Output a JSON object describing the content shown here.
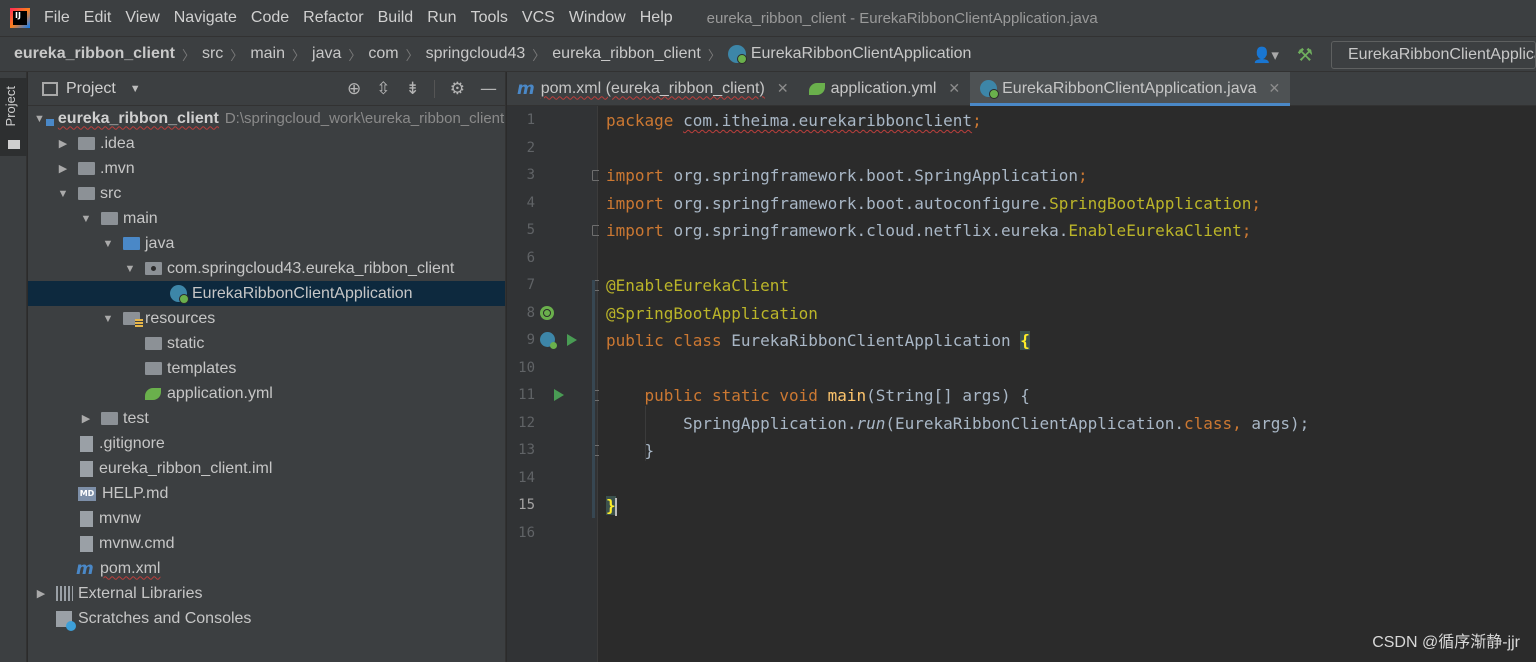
{
  "menubar": {
    "logo_text": "IJ",
    "items": [
      "File",
      "Edit",
      "View",
      "Navigate",
      "Code",
      "Refactor",
      "Build",
      "Run",
      "Tools",
      "VCS",
      "Window",
      "Help"
    ],
    "window_title": "eureka_ribbon_client - EurekaRibbonClientApplication.java"
  },
  "breadcrumb": [
    "eureka_ribbon_client",
    "src",
    "main",
    "java",
    "com",
    "springcloud43",
    "eureka_ribbon_client",
    "EurekaRibbonClientApplication"
  ],
  "toolbar": {
    "run_config": "EurekaRibbonClientApplication",
    "user_icon": "user-icon",
    "build_icon": "hammer-icon"
  },
  "left_strip": {
    "project_label": "Project"
  },
  "project_panel": {
    "title": "Project",
    "tree": [
      {
        "name": "eureka_ribbon_client",
        "path": "D:\\springcloud_work\\eureka_ribbon_client",
        "icon": "project-folder",
        "expanded": true
      },
      {
        "name": ".idea",
        "icon": "folder",
        "expanded": false
      },
      {
        "name": ".mvn",
        "icon": "folder",
        "expanded": false
      },
      {
        "name": "src",
        "icon": "folder",
        "expanded": true
      },
      {
        "name": "main",
        "icon": "folder",
        "expanded": true
      },
      {
        "name": "java",
        "icon": "source-folder",
        "expanded": true
      },
      {
        "name": "com.springcloud43.eureka_ribbon_client",
        "icon": "package",
        "expanded": true
      },
      {
        "name": "EurekaRibbonClientApplication",
        "icon": "spring-class",
        "selected": true
      },
      {
        "name": "resources",
        "icon": "resources-folder",
        "expanded": true
      },
      {
        "name": "static",
        "icon": "folder"
      },
      {
        "name": "templates",
        "icon": "folder"
      },
      {
        "name": "application.yml",
        "icon": "spring-yml"
      },
      {
        "name": "test",
        "icon": "folder",
        "expanded": false
      },
      {
        "name": ".gitignore",
        "icon": "file"
      },
      {
        "name": "eureka_ribbon_client.iml",
        "icon": "file"
      },
      {
        "name": "HELP.md",
        "icon": "md-file"
      },
      {
        "name": "mvnw",
        "icon": "file"
      },
      {
        "name": "mvnw.cmd",
        "icon": "file"
      },
      {
        "name": "pom.xml",
        "icon": "maven"
      },
      {
        "name": "External Libraries",
        "icon": "libraries",
        "expanded": false
      },
      {
        "name": "Scratches and Consoles",
        "icon": "scratches"
      }
    ]
  },
  "editor_tabs": [
    {
      "label": "pom.xml (eureka_ribbon_client)",
      "icon": "maven",
      "active": false
    },
    {
      "label": "application.yml",
      "icon": "spring-yml",
      "active": false
    },
    {
      "label": "EurekaRibbonClientApplication.java",
      "icon": "spring-class",
      "active": true
    }
  ],
  "code": {
    "current_line": 15,
    "line_numbers": [
      "1",
      "2",
      "3",
      "4",
      "5",
      "6",
      "7",
      "8",
      "9",
      "10",
      "11",
      "12",
      "13",
      "14",
      "15",
      "16"
    ],
    "l1": {
      "kw": "package",
      "pkg": "com.itheima.eurekaribbonclient",
      "semi": ";"
    },
    "l3": {
      "kw": "import",
      "path": "org.springframework.boot.SpringApplication",
      "semi": ";"
    },
    "l4": {
      "kw": "import",
      "path": "org.springframework.boot.autoconfigure.",
      "cls": "SpringBootApplication",
      "semi": ";"
    },
    "l5": {
      "kw": "import",
      "path": "org.springframework.cloud.netflix.eureka.",
      "cls": "EnableEurekaClient",
      "semi": ";"
    },
    "l7": {
      "ann": "@EnableEurekaClient"
    },
    "l8": {
      "ann": "@SpringBootApplication"
    },
    "l9": {
      "kw": "public class",
      "name": "EurekaRibbonClientApplication",
      "brace": "{"
    },
    "l11": {
      "kw": "public static void",
      "fn": "main",
      "rest": "(String[] args) {"
    },
    "l12": {
      "obj": "SpringApplication.",
      "method": "run",
      "open": "(EurekaRibbonClientApplication.",
      "kw": "class",
      "comma": ",",
      "rest": " args);"
    },
    "l13": {
      "text": "}"
    },
    "l15": {
      "brace": "}"
    }
  },
  "watermark": "CSDN @循序渐静-jjr"
}
